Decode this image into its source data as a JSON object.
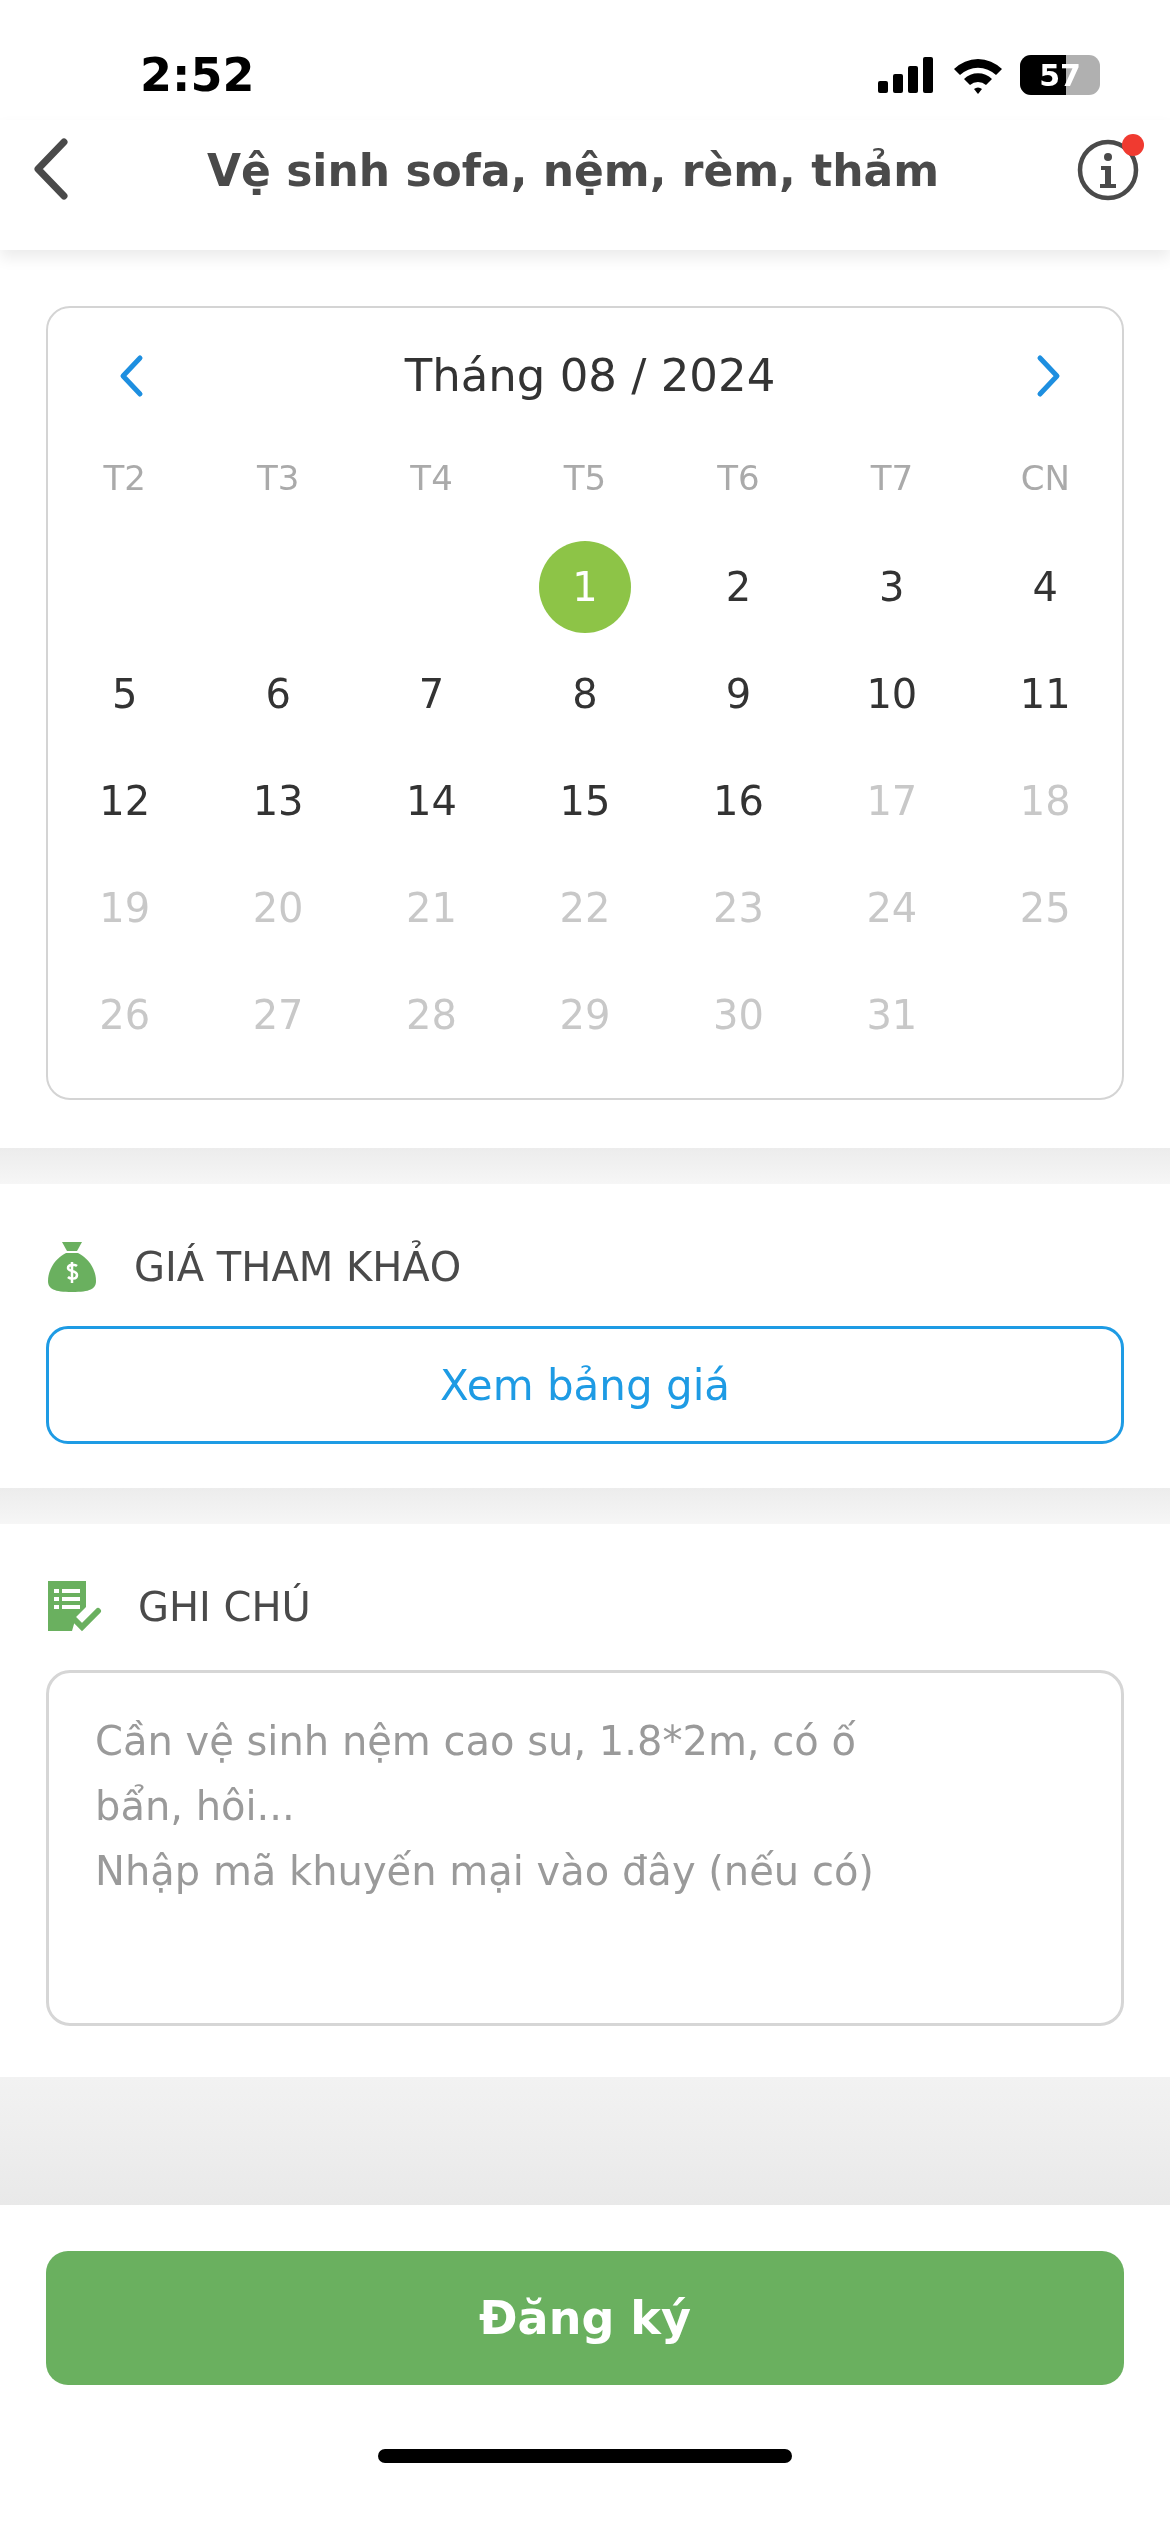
{
  "status_bar": {
    "time": "2:52",
    "battery": "57"
  },
  "nav": {
    "title": "Vệ sinh sofa, nệm, rèm, thảm",
    "info_badge": true
  },
  "schedule": {
    "calendar": {
      "month": "Tháng 08 / 2024",
      "weekdays": [
        "T2",
        "T3",
        "T4",
        "T5",
        "T6",
        "T7",
        "CN"
      ],
      "weeks": [
        [
          {
            "label": "1",
            "selected": true,
            "disabled": false
          },
          {
            "label": "2",
            "selected": false,
            "disabled": false
          },
          {
            "label": "3",
            "selected": false,
            "disabled": false
          },
          {
            "label": "4",
            "selected": false,
            "disabled": false
          }
        ],
        [
          {
            "label": "5",
            "selected": false,
            "disabled": false
          },
          {
            "label": "6",
            "selected": false,
            "disabled": false
          },
          {
            "label": "7",
            "selected": false,
            "disabled": false
          },
          {
            "label": "8",
            "selected": false,
            "disabled": false
          },
          {
            "label": "9",
            "selected": false,
            "disabled": false
          },
          {
            "label": "10",
            "selected": false,
            "disabled": false
          },
          {
            "label": "11",
            "selected": false,
            "disabled": false
          }
        ],
        [
          {
            "label": "12",
            "selected": false,
            "disabled": false
          },
          {
            "label": "13",
            "selected": false,
            "disabled": false
          },
          {
            "label": "14",
            "selected": false,
            "disabled": false
          },
          {
            "label": "15",
            "selected": false,
            "disabled": false
          },
          {
            "label": "16",
            "selected": false,
            "disabled": false
          },
          {
            "label": "17",
            "selected": false,
            "disabled": true
          },
          {
            "label": "18",
            "selected": false,
            "disabled": true
          }
        ],
        [
          {
            "label": "19",
            "selected": false,
            "disabled": true
          },
          {
            "label": "20",
            "selected": false,
            "disabled": true
          },
          {
            "label": "21",
            "selected": false,
            "disabled": true
          },
          {
            "label": "22",
            "selected": false,
            "disabled": true
          },
          {
            "label": "23",
            "selected": false,
            "disabled": true
          },
          {
            "label": "24",
            "selected": false,
            "disabled": true
          },
          {
            "label": "25",
            "selected": false,
            "disabled": true
          }
        ],
        [
          {
            "label": "26",
            "selected": false,
            "disabled": true
          },
          {
            "label": "27",
            "selected": false,
            "disabled": true
          },
          {
            "label": "28",
            "selected": false,
            "disabled": true
          },
          {
            "label": "29",
            "selected": false,
            "disabled": true
          },
          {
            "label": "30",
            "selected": false,
            "disabled": true
          },
          {
            "label": "31",
            "selected": false,
            "disabled": true
          }
        ]
      ]
    }
  },
  "price": {
    "header": "GIÁ THAM KHẢO",
    "button": "Xem bảng giá"
  },
  "note": {
    "header": "GHI CHÚ",
    "placeholder": "Cần vệ sinh nệm cao su, 1.8*2m, có ố bẩn, hôi...\nNhập mã khuyến mại vào đây (nếu có)"
  },
  "submit": "Đăng ký"
}
